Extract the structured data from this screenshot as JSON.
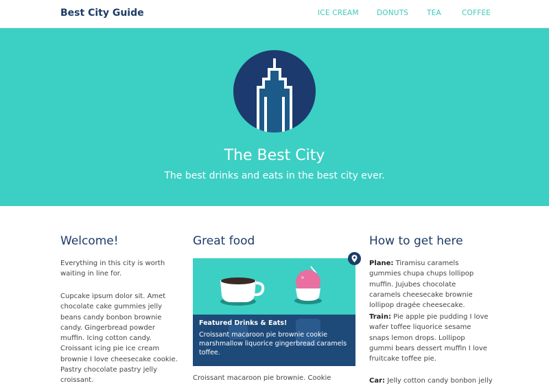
{
  "header": {
    "brand": "Best City Guide",
    "nav": [
      "ICE CREAM",
      "DONUTS",
      "TEA",
      "COFFEE"
    ]
  },
  "hero": {
    "title": "The Best City",
    "subtitle": "The best drinks and eats in the best city ever."
  },
  "welcome": {
    "title": "Welcome!",
    "p1": "Everything in this city is worth waiting in line for.",
    "p2": "Cupcake ipsum dolor sit. Amet chocolate cake gummies jelly beans candy bonbon brownie candy. Gingerbread powder muffin. Icing cotton candy. Croissant icing pie ice cream brownie I love cheesecake cookie. Pastry chocolate pastry jelly croissant."
  },
  "food": {
    "title": "Great food",
    "featured_title": "Featured Drinks & Eats!",
    "featured_text": "Croissant macaroon pie brownie cookie marshmallow liquorice gingerbread caramels toffee.",
    "body": "Croissant macaroon pie brownie. Cookie"
  },
  "directions": {
    "title": "How to get here",
    "items": [
      {
        "label": "Plane:",
        "text": "Tiramisu caramels gummies chupa chups lollipop muffin. Jujubes chocolate caramels cheesecake brownie lollipop dragée cheesecake."
      },
      {
        "label": "Train:",
        "text": "Pie apple pie pudding I love wafer toffee liquorice sesame snaps lemon drops. Lollipop gummi bears dessert muffin I love fruitcake toffee pie."
      },
      {
        "label": "Car:",
        "text": "Jelly cotton candy bonbon jelly-o"
      }
    ]
  },
  "colors": {
    "accent": "#3ccfc4",
    "navy": "#1c3c68",
    "featured_bg": "#1e4a7a"
  },
  "icons": [
    "building-logo-icon",
    "coffee-cup-icon",
    "ice-cream-icon",
    "map-pin-icon"
  ]
}
